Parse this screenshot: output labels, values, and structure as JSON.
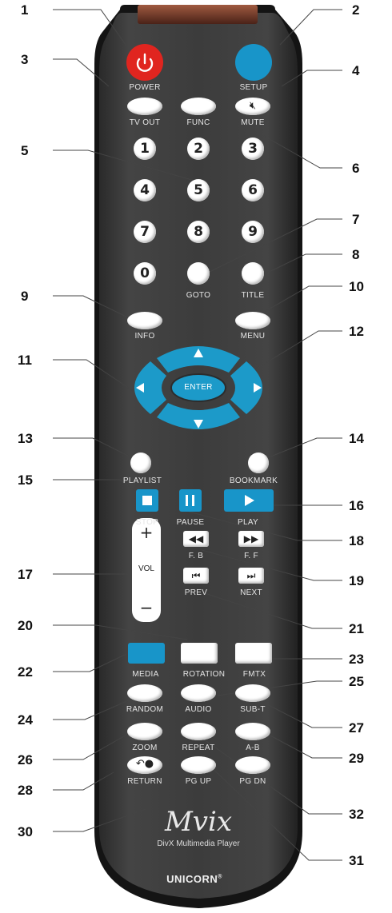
{
  "callouts": [
    "1",
    "2",
    "3",
    "4",
    "5",
    "6",
    "7",
    "8",
    "9",
    "10",
    "11",
    "12",
    "13",
    "14",
    "15",
    "16",
    "17",
    "18",
    "19",
    "20",
    "21",
    "22",
    "23",
    "24",
    "25",
    "26",
    "27",
    "28",
    "29",
    "30",
    "31",
    "32"
  ],
  "labels": {
    "power": "POWER",
    "setup": "SETUP",
    "tv_out": "TV OUT",
    "func": "FUNC",
    "mute": "MUTE",
    "goto": "GOTO",
    "title": "TITLE",
    "info": "INFO",
    "menu": "MENU",
    "enter": "ENTER",
    "playlist": "PLAYLIST",
    "bookmark": "BOOKMARK",
    "stop": "STOP",
    "pause": "PAUSE",
    "play": "PLAY",
    "vol": "VOL",
    "vol_plus": "+",
    "vol_minus": "−",
    "fb": "F. B",
    "ff": "F. F",
    "prev": "PREV",
    "next": "NEXT",
    "media": "MEDIA",
    "rotation": "ROTATION",
    "fmtx": "FMTX",
    "random": "RANDOM",
    "audio": "AUDIO",
    "sub_t": "SUB-T",
    "zoom": "ZOOM",
    "repeat": "REPEAT",
    "a_b": "A-B",
    "return": "RETURN",
    "pg_up": "PG UP",
    "pg_dn": "PG DN"
  },
  "number_keys": [
    "1",
    "2",
    "3",
    "4",
    "5",
    "6",
    "7",
    "8",
    "9",
    "0"
  ],
  "brand": {
    "logo": "Mvix",
    "tagline": "DivX Multimedia Player",
    "maker": "UNICORN",
    "maker_mark": "®"
  },
  "colors": {
    "body": "#3a3a3a",
    "body_edge": "#1a1a1a",
    "power": "#e0251f",
    "setup": "#1895c9",
    "nav": "#1c9ac9",
    "ir_window": "#7a3a2a"
  }
}
